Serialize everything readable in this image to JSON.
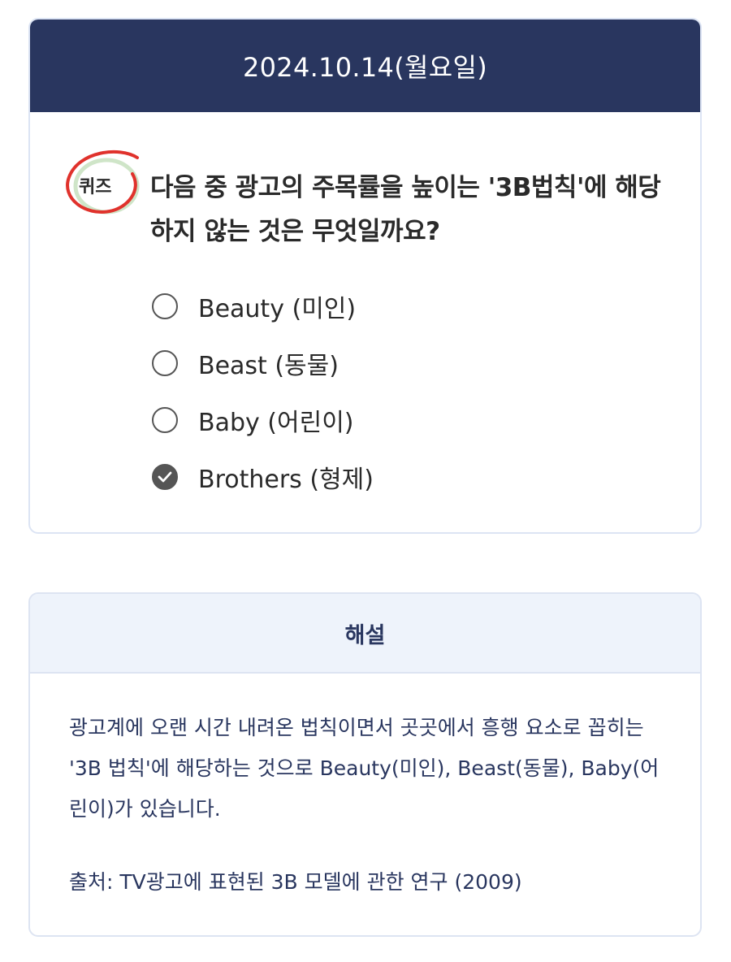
{
  "quiz": {
    "date": "2024.10.14(월요일)",
    "badge_label": "퀴즈",
    "question": "다음 중 광고의 주목률을 높이는 '3B법칙'에 해당하지 않는 것은 무엇일까요?",
    "options": [
      {
        "label": "Beauty (미인)",
        "selected": false
      },
      {
        "label": "Beast (동물)",
        "selected": false
      },
      {
        "label": "Baby (어린이)",
        "selected": false
      },
      {
        "label": "Brothers (형제)",
        "selected": true
      }
    ]
  },
  "explanation": {
    "title": "해설",
    "body": "광고계에 오랜 시간 내려온 법칙이면서 곳곳에서 흥행 요소로 꼽히는 '3B 법칙'에 해당하는 것으로 Beauty(미인), Beast(동물), Baby(어린이)가 있습니다.",
    "source": "출처: TV광고에 표현된 3B 모델에 관한 연구 (2009)"
  },
  "colors": {
    "header_bg": "#29365f",
    "accent_text": "#29365f",
    "badge_circle_red": "#e0322c",
    "badge_circle_green": "#cfe5c8",
    "selected_radio": "#555555"
  }
}
